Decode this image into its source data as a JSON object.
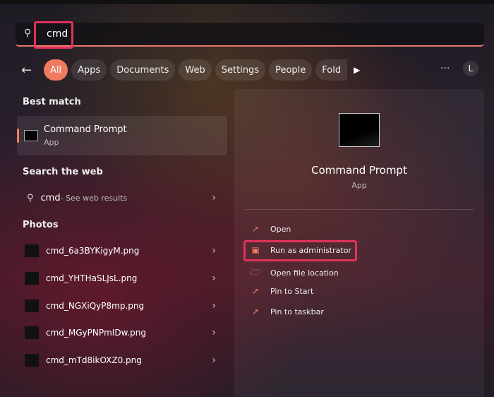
{
  "search": {
    "value": "cmd"
  },
  "filters": {
    "items": [
      "All",
      "Apps",
      "Documents",
      "Web",
      "Settings",
      "People",
      "Fold"
    ],
    "more": "···",
    "avatar": "L"
  },
  "best_match": {
    "heading": "Best match",
    "title": "Command Prompt",
    "subtitle": "App"
  },
  "web": {
    "heading": "Search the web",
    "query": "cmd",
    "suffix": " - See web results"
  },
  "photos": {
    "heading": "Photos",
    "items": [
      "cmd_6a3BYKigyM.png",
      "cmd_YHTHaSLJsL.png",
      "cmd_NGXiQyP8mp.png",
      "cmd_MGyPNPmIDw.png",
      "cmd_mTd8ikOXZ0.png"
    ]
  },
  "detail": {
    "title": "Command Prompt",
    "subtitle": "App",
    "actions": [
      "Open",
      "Run as administrator",
      "Open file location",
      "Pin to Start",
      "Pin to taskbar"
    ]
  },
  "colors": {
    "accent": "#ef7c5f",
    "highlight": "#e0325a"
  }
}
